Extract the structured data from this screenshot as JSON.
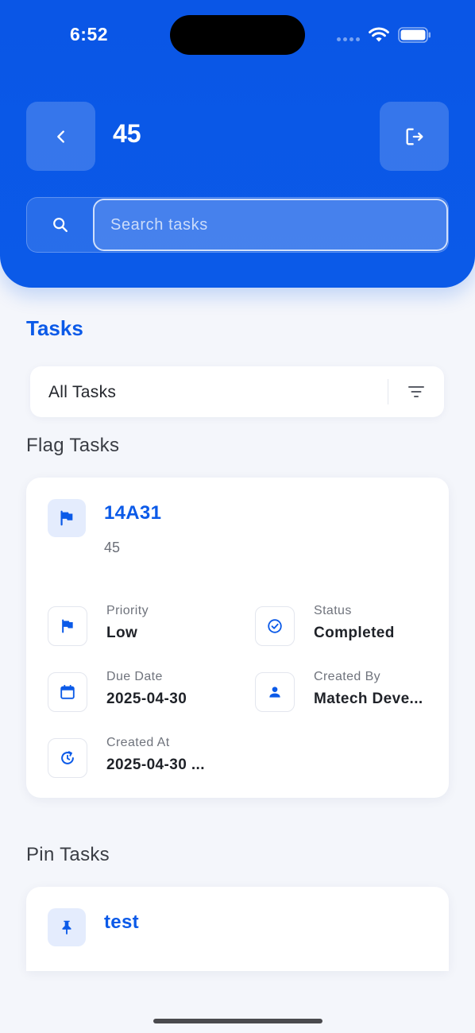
{
  "status_bar": {
    "time": "6:52"
  },
  "header": {
    "title": "45",
    "search_placeholder": "Search tasks"
  },
  "tasks_section": {
    "heading": "Tasks",
    "filter": {
      "selected": "All Tasks"
    }
  },
  "flag_tasks": {
    "title": "Flag Tasks",
    "task": {
      "title": "14A31",
      "description": "45",
      "priority_label": "Priority",
      "priority_value": "Low",
      "status_label": "Status",
      "status_value": "Completed",
      "due_label": "Due Date",
      "due_value": "2025-04-30",
      "created_by_label": "Created By",
      "created_by_value": "Matech Deve...",
      "created_at_label": "Created At",
      "created_at_value": "2025-04-30 ..."
    }
  },
  "pin_tasks": {
    "title": "Pin Tasks",
    "task": {
      "title": "test"
    }
  },
  "icons": {
    "back": "chevron-left-icon",
    "logout": "logout-icon",
    "search": "search-icon",
    "filter": "filter-icon",
    "flag": "flag-icon",
    "status": "check-circle-icon",
    "calendar": "calendar-icon",
    "person": "person-icon",
    "created_at": "clock-refresh-icon",
    "pin": "pin-icon"
  },
  "colors": {
    "primary": "#0b5ae8",
    "background": "#f4f6fb",
    "card": "#ffffff"
  }
}
